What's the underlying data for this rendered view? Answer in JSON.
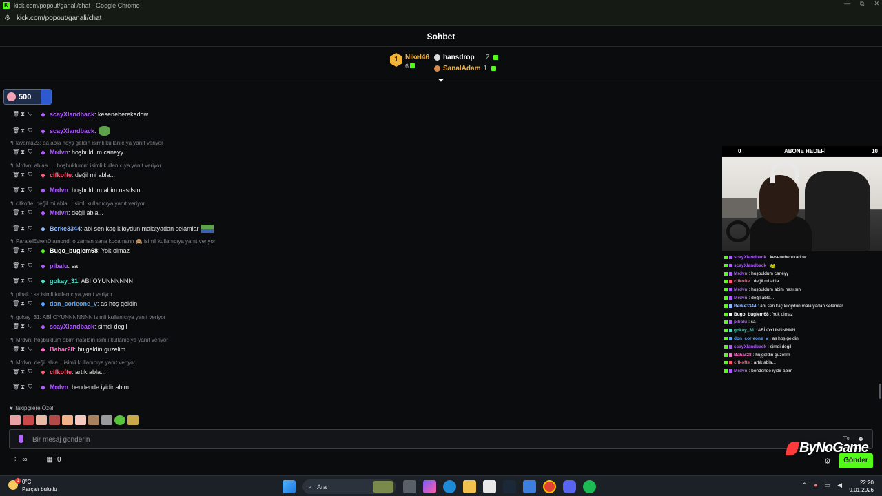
{
  "browser": {
    "window_title": "kick.com/popout/ganali/chat - Google Chrome",
    "url": "kick.com/popout/ganali/chat",
    "logo_letter": "K",
    "url_icon": "tune-icon",
    "win_min": "—",
    "win_max": "⧉",
    "win_close": "✕"
  },
  "chat": {
    "title": "Sohbet",
    "leaderboard": {
      "first": {
        "rank": "1",
        "name": "Nikel46",
        "count": "6"
      },
      "second": {
        "name": "hansdrop",
        "count": "2"
      },
      "third": {
        "name": "SanalAdam",
        "count": "1"
      }
    },
    "pinned": {
      "value": "500"
    },
    "messages": [
      {
        "user": "scayXlandback",
        "text": ": keseneberekadow",
        "color": "#b05cff"
      },
      {
        "user": "scayXlandback",
        "text": ":",
        "color": "#b05cff",
        "emote": true
      },
      {
        "reply": "lavanta23: aa abla hoyş geldin isimli kullanıcıya yanıt veriyor"
      },
      {
        "user": "Mrdvn",
        "text": ": hoşbuldum caneyy",
        "color": "#b05cff"
      },
      {
        "reply": "Mrdvn: ablaa..... hoşbuldumm isimli kullanıcıya yanıt veriyor"
      },
      {
        "user": "cifkofte",
        "text": ": değil mi abla...",
        "color": "#ff5c7a"
      },
      {
        "user": "Mrdvn",
        "text": ": hoşbuldum abim nasılsın",
        "color": "#b05cff"
      },
      {
        "reply": "cifkofte: değil mi abla... isimli kullanıcıya yanıt veriyor"
      },
      {
        "user": "Mrdvn",
        "text": ": değil abla...",
        "color": "#b05cff"
      },
      {
        "user": "Berke3344",
        "text": ": abi sen kaç kiloydun malatyadan selamlar",
        "color": "#8fb8ff",
        "emote2": true
      },
      {
        "reply": "ParalelEvrenDiamond: o zaman sana kocamann 🙈 isimli kullanıcıya yanıt veriyor"
      },
      {
        "user": "Bugo_buglem68",
        "text": ": Yok olmaz",
        "color": "#ffffff"
      },
      {
        "user": "pibalu",
        "text": ": sa",
        "color": "#b05cff"
      },
      {
        "user": "gokay_31",
        "text": ": ABİ OYUNNNNNN",
        "color": "#4ddfc8"
      },
      {
        "reply": "pibalu: sa isimli kullanıcıya yanıt veriyor"
      },
      {
        "user": "don_corleone_v",
        "text": ": as hoş geldin",
        "color": "#5aa7ff"
      },
      {
        "reply": "gokay_31: ABİ OYUNNNNNNN isimli kullanıcıya yanıt veriyor"
      },
      {
        "user": "scayXlandback",
        "text": ": simdi degil",
        "color": "#b05cff"
      },
      {
        "reply": "Mrdvn: hoşbuldum abim nasılsın isimli kullanıcıya yanıt veriyor"
      },
      {
        "user": "Bahar28",
        "text": ": hujgeldin guzelim",
        "color": "#ff6ec7"
      },
      {
        "reply": "Mrdvn: değil abla... isimli kullanıcıya yanıt veriyor"
      },
      {
        "user": "cifkofte",
        "text": ": artık abla...",
        "color": "#ff5c7a"
      },
      {
        "user": "Mrdvn",
        "text": ": bendende iyidir abim",
        "color": "#b05cff"
      }
    ],
    "follower_label": "♥ Takipçilere Özel",
    "input_placeholder": "Bir mesaj gönderin",
    "input_right_1": "Tᵒ",
    "input_right_2": "☻",
    "bottom_infinity": "∞",
    "bottom_count": "0",
    "send_label": "Gönder",
    "settings_icon": "⚙"
  },
  "overlay": {
    "goal_left": "0",
    "goal_title": "ABONE HEDEFİ",
    "goal_right": "10",
    "rows": [
      {
        "user": "scayXlandback",
        "text": ": keseneberekadow",
        "color": "#b05cff"
      },
      {
        "user": "scayXlandback",
        "text": ": 🐸",
        "color": "#b05cff"
      },
      {
        "user": "Mrdvn",
        "text": ": hoşbuldum caneyy",
        "color": "#b05cff"
      },
      {
        "user": "cifkofte",
        "text": ": değil mi abla...",
        "color": "#ff5c7a"
      },
      {
        "user": "Mrdvn",
        "text": ": hoşbuldum abim nasılsın",
        "color": "#b05cff"
      },
      {
        "user": "Mrdvn",
        "text": ": değil abla...",
        "color": "#b05cff"
      },
      {
        "user": "Berke3344",
        "text": ": abi sen kaç kiloydun malatyadan selamlar",
        "color": "#8fb8ff"
      },
      {
        "user": "Bugo_buglem68",
        "text": ": Yok olmaz",
        "color": "#ffffff"
      },
      {
        "user": "pibalu",
        "text": ": sa",
        "color": "#b05cff"
      },
      {
        "user": "gokay_31",
        "text": ": ABİ OYUNNNNNN",
        "color": "#4ddfc8"
      },
      {
        "user": "don_corleone_v",
        "text": ": as hoş geldin",
        "color": "#5aa7ff"
      },
      {
        "user": "scayXlandback",
        "text": ": simdi degil",
        "color": "#b05cff"
      },
      {
        "user": "Bahar28",
        "text": ": hujgeldin guzelim",
        "color": "#ff6ec7"
      },
      {
        "user": "cifkofte",
        "text": ": artık abla...",
        "color": "#ff5c7a"
      },
      {
        "user": "Mrdvn",
        "text": ": bendende iyidir abim",
        "color": "#b05cff"
      }
    ]
  },
  "watermark": "ByNoGame",
  "taskbar": {
    "temp": "0°C",
    "weather": "Parçalı bulutlu",
    "weather_badge": "1",
    "search_label": "Ara",
    "time": "22:20",
    "date": "9.01.2026"
  }
}
